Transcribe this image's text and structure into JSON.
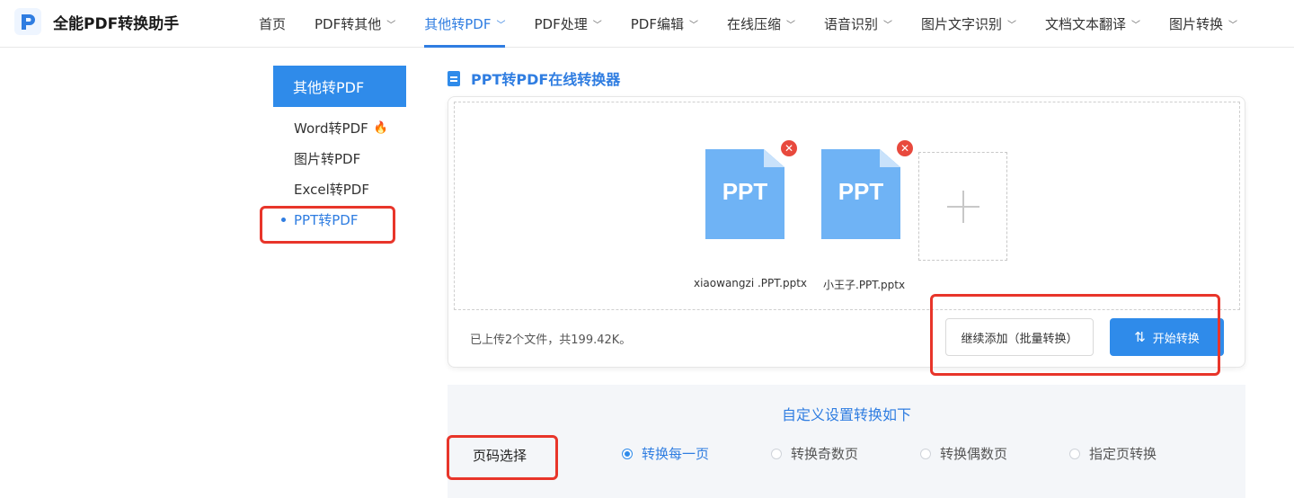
{
  "app": {
    "name": "全能PDF转换助手"
  },
  "nav": {
    "items": [
      {
        "label": "首页",
        "chevron": false
      },
      {
        "label": "PDF转其他",
        "chevron": true
      },
      {
        "label": "其他转PDF",
        "chevron": true,
        "active": true
      },
      {
        "label": "PDF处理",
        "chevron": true
      },
      {
        "label": "PDF编辑",
        "chevron": true
      },
      {
        "label": "在线压缩",
        "chevron": true
      },
      {
        "label": "语音识别",
        "chevron": true
      },
      {
        "label": "图片文字识别",
        "chevron": true
      },
      {
        "label": "文档文本翻译",
        "chevron": true
      },
      {
        "label": "图片转换",
        "chevron": true
      }
    ]
  },
  "sidebar": {
    "title": "其他转PDF",
    "items": [
      {
        "label": "Word转PDF",
        "hot": true
      },
      {
        "label": "图片转PDF"
      },
      {
        "label": "Excel转PDF"
      },
      {
        "label": "PPT转PDF",
        "active": true
      }
    ]
  },
  "converter": {
    "title": "PPT转PDF在线转换器",
    "files": [
      {
        "icon_text": "PPT",
        "name": "xiaowangzi .PPT.pptx"
      },
      {
        "icon_text": "PPT",
        "name": "小王子.PPT.pptx"
      }
    ],
    "status": "已上传2个文件，共199.42K。",
    "add_more_label": "继续添加（批量转换）",
    "start_label": "开始转换"
  },
  "settings": {
    "title": "自定义设置转换如下",
    "page_label": "页码选择",
    "options": [
      {
        "label": "转换每一页",
        "checked": true
      },
      {
        "label": "转换奇数页"
      },
      {
        "label": "转换偶数页"
      },
      {
        "label": "指定页转换"
      }
    ]
  },
  "colors": {
    "accent": "#2f8bea",
    "annotation": "#e8352a",
    "file_icon": "#6fb3f5",
    "delete": "#e8493d"
  }
}
